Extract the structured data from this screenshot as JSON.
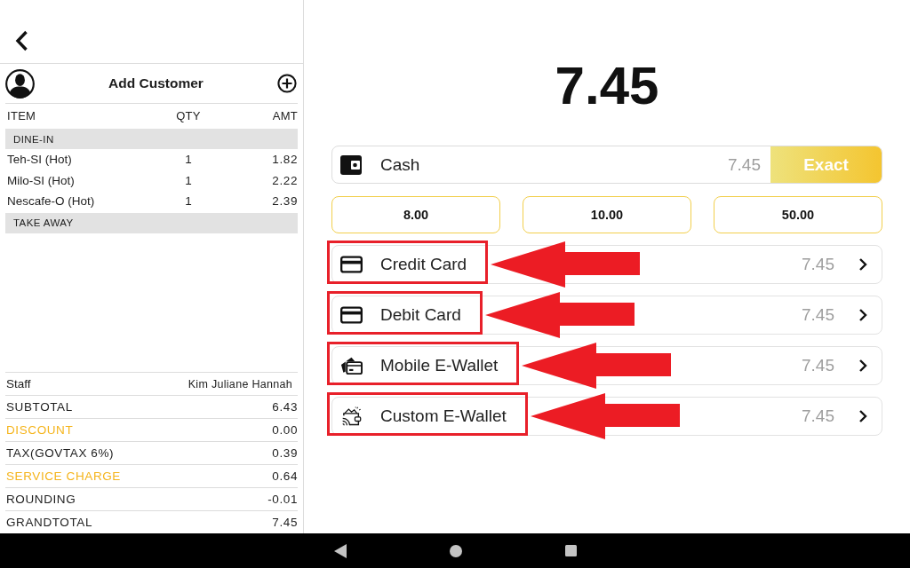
{
  "customer": {
    "label": "Add Customer"
  },
  "order": {
    "columns": [
      "ITEM",
      "QTY",
      "AMT"
    ],
    "groups": [
      {
        "name": "DINE-IN",
        "items": [
          {
            "name": "Teh-SI (Hot)",
            "qty": "1",
            "amount": "1.82"
          },
          {
            "name": "Milo-SI (Hot)",
            "qty": "1",
            "amount": "2.22"
          },
          {
            "name": "Nescafe-O (Hot)",
            "qty": "1",
            "amount": "2.39"
          }
        ]
      },
      {
        "name": "TAKE AWAY"
      }
    ]
  },
  "staff": {
    "label": "Staff",
    "value": "Kim Juliane Hannah"
  },
  "summary": [
    {
      "label": "SUBTOTAL",
      "value": "6.43",
      "color": "#1e1e1e"
    },
    {
      "label": "DISCOUNT",
      "value": "0.00",
      "color": "#f5b41b"
    },
    {
      "label": "TAX(GOVTAX 6%)",
      "value": "0.39",
      "color": "#1e1e1e"
    },
    {
      "label": "SERVICE CHARGE",
      "value": "0.64",
      "color": "#f5b41b"
    },
    {
      "label": "ROUNDING",
      "value": "-0.01",
      "color": "#1e1e1e"
    },
    {
      "label": "GRANDTOTAL",
      "value": "7.45",
      "color": "#1e1e1e"
    }
  ],
  "total": "7.45",
  "cash": {
    "label": "Cash",
    "amount": "7.45",
    "exact_label": "Exact"
  },
  "quick_amounts": [
    "8.00",
    "10.00",
    "50.00"
  ],
  "methods": [
    {
      "label": "Credit Card",
      "amount": "7.45",
      "kind": "card",
      "highlighted": true
    },
    {
      "label": "Debit Card",
      "amount": "7.45",
      "kind": "card",
      "highlighted": true
    },
    {
      "label": "Mobile E-Wallet",
      "amount": "7.45",
      "kind": "cards",
      "highlighted": true
    },
    {
      "label": "Custom E-Wallet",
      "amount": "7.45",
      "kind": "wallet",
      "highlighted": true
    }
  ]
}
